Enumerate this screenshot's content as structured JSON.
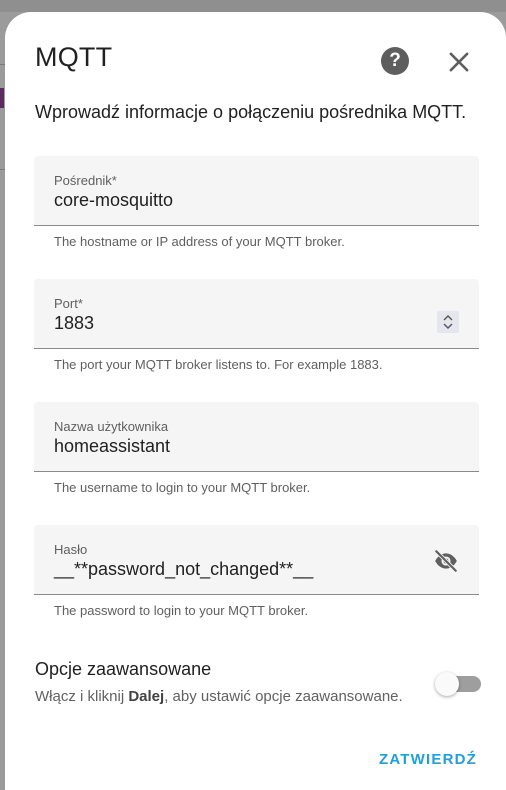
{
  "dialog": {
    "title": "MQTT",
    "description": "Wprowadź informacje o połączeniu pośrednika MQTT.",
    "help_icon": "help-circle-icon",
    "close_icon": "close-icon"
  },
  "fields": {
    "broker": {
      "label": "Pośrednik*",
      "value": "core-mosquitto",
      "helper": "The hostname or IP address of your MQTT broker."
    },
    "port": {
      "label": "Port*",
      "value": "1883",
      "helper": "The port your MQTT broker listens to. For example 1883."
    },
    "username": {
      "label": "Nazwa użytkownika",
      "value": "homeassistant",
      "helper": "The username to login to your MQTT broker."
    },
    "password": {
      "label": "Hasło",
      "value": "__**password_not_changed**__",
      "helper": "The password to login to your MQTT broker.",
      "visibility_icon": "eye-off-icon"
    }
  },
  "advanced": {
    "title": "Opcje zaawansowane",
    "desc_before": "Włącz i kliknij ",
    "desc_bold": "Dalej",
    "desc_after": ", aby ustawić opcje zaawansowane.",
    "enabled": false
  },
  "actions": {
    "submit_label": "ZATWIERDŹ"
  },
  "colors": {
    "accent": "#1ea0d8",
    "background_overlay": "#9e9e9e"
  }
}
